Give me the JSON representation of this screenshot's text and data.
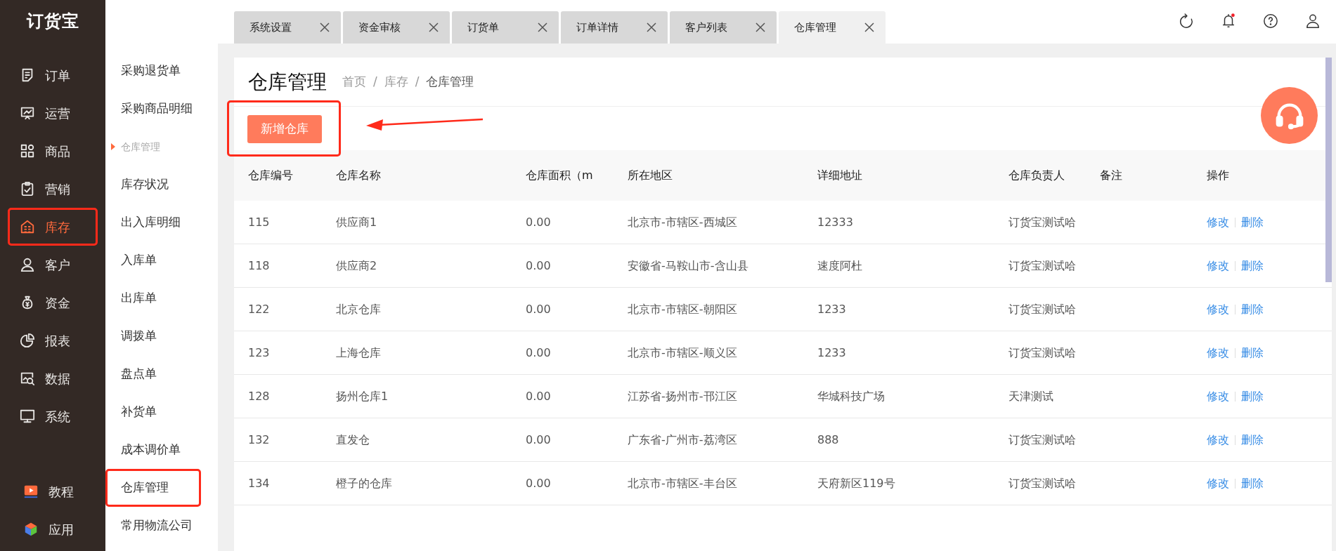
{
  "logo": "订货宝",
  "rail": {
    "items": [
      {
        "label": "订单",
        "selected": false,
        "highlighted": false
      },
      {
        "label": "运营",
        "selected": false,
        "highlighted": false
      },
      {
        "label": "商品",
        "selected": false,
        "highlighted": false
      },
      {
        "label": "营销",
        "selected": false,
        "highlighted": false
      },
      {
        "label": "库存",
        "selected": true,
        "highlighted": true
      },
      {
        "label": "客户",
        "selected": false,
        "highlighted": false
      },
      {
        "label": "资金",
        "selected": false,
        "highlighted": false
      },
      {
        "label": "报表",
        "selected": false,
        "highlighted": false
      },
      {
        "label": "数据",
        "selected": false,
        "highlighted": false
      },
      {
        "label": "系统",
        "selected": false,
        "highlighted": false
      }
    ],
    "bottom_items": [
      {
        "label": "教程"
      },
      {
        "label": "应用"
      }
    ]
  },
  "submenu": [
    {
      "kind": "link",
      "label": "采购退货单",
      "highlighted": false
    },
    {
      "kind": "link",
      "label": "采购商品明细",
      "highlighted": false
    },
    {
      "kind": "section",
      "label": "仓库管理"
    },
    {
      "kind": "link",
      "label": "库存状况",
      "highlighted": false
    },
    {
      "kind": "link",
      "label": "出入库明细",
      "highlighted": false
    },
    {
      "kind": "link",
      "label": "入库单",
      "highlighted": false
    },
    {
      "kind": "link",
      "label": "出库单",
      "highlighted": false
    },
    {
      "kind": "link",
      "label": "调拨单",
      "highlighted": false
    },
    {
      "kind": "link",
      "label": "盘点单",
      "highlighted": false
    },
    {
      "kind": "link",
      "label": "补货单",
      "highlighted": false
    },
    {
      "kind": "link",
      "label": "成本调价单",
      "highlighted": false
    },
    {
      "kind": "link",
      "label": "仓库管理",
      "highlighted": true
    },
    {
      "kind": "link",
      "label": "常用物流公司",
      "highlighted": false
    }
  ],
  "tabs": [
    {
      "label": "系统设置",
      "selected": false
    },
    {
      "label": "资金审核",
      "selected": false
    },
    {
      "label": "订货单",
      "selected": false
    },
    {
      "label": "订单详情",
      "selected": false
    },
    {
      "label": "客户列表",
      "selected": false
    },
    {
      "label": "仓库管理",
      "selected": true
    }
  ],
  "header": {
    "notification_dot": true
  },
  "page": {
    "title": "仓库管理",
    "breadcrumb": [
      {
        "kind": "link",
        "label": "首页"
      },
      {
        "kind": "separator",
        "label": "/"
      },
      {
        "kind": "link",
        "label": "库存"
      },
      {
        "kind": "separator",
        "label": "/"
      },
      {
        "kind": "current",
        "label": "仓库管理"
      }
    ],
    "add_button": {
      "label": "新增仓库",
      "highlighted": true,
      "annotation_arrow": true
    }
  },
  "table": {
    "columns": [
      "仓库编号",
      "仓库名称",
      "仓库面积（m",
      "所在地区",
      "详细地址",
      "仓库负责人",
      "备注",
      "操作"
    ],
    "rows": [
      {
        "cells": [
          "115",
          "供应商1",
          "0.00",
          "北京市-市辖区-西城区",
          "12333",
          "订货宝测试哈"
        ],
        "actions": [
          "修改",
          "删除"
        ]
      },
      {
        "cells": [
          "118",
          "供应商2",
          "0.00",
          "安徽省-马鞍山市-含山县",
          "速度阿杜",
          "订货宝测试哈"
        ],
        "actions": [
          "修改",
          "删除"
        ]
      },
      {
        "cells": [
          "122",
          "北京仓库",
          "0.00",
          "北京市-市辖区-朝阳区",
          "1233",
          "订货宝测试哈"
        ],
        "actions": [
          "修改",
          "删除"
        ]
      },
      {
        "cells": [
          "123",
          "上海仓库",
          "0.00",
          "北京市-市辖区-顺义区",
          "1233",
          "订货宝测试哈"
        ],
        "actions": [
          "修改",
          "删除"
        ]
      },
      {
        "cells": [
          "128",
          "扬州仓库1",
          "0.00",
          "江苏省-扬州市-邗江区",
          "华城科技广场",
          "天津测试"
        ],
        "actions": [
          "修改",
          "删除"
        ]
      },
      {
        "cells": [
          "132",
          "直发仓",
          "0.00",
          "广东省-广州市-荔湾区",
          "888",
          "订货宝测试哈"
        ],
        "actions": [
          "修改",
          "删除"
        ]
      },
      {
        "cells": [
          "134",
          "橙子的仓库",
          "0.00",
          "北京市-市辖区-丰台区",
          "天府新区119号",
          "订货宝测试哈"
        ],
        "actions": [
          "修改",
          "删除"
        ]
      }
    ]
  }
}
